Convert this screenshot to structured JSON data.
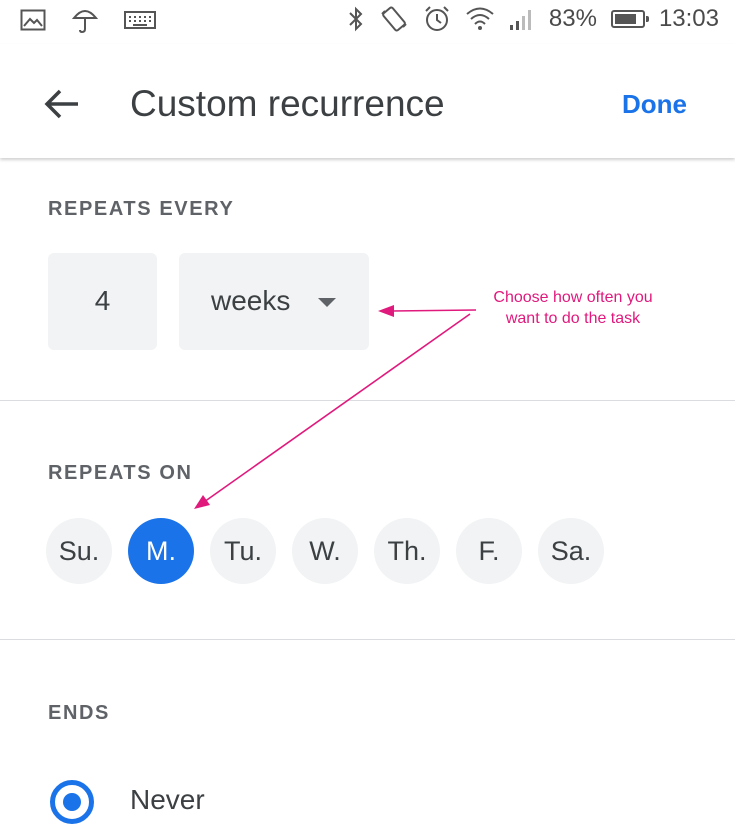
{
  "status_bar": {
    "battery_percent": "83%",
    "battery_level": 0.83,
    "time": "13:03",
    "icons": [
      "image-icon",
      "umbrella-icon",
      "keyboard-icon",
      "bluetooth-icon",
      "vibrate-icon",
      "alarm-icon",
      "wifi-icon",
      "signal-icon",
      "battery-icon"
    ]
  },
  "app_bar": {
    "title": "Custom recurrence",
    "done_label": "Done",
    "back_icon": "arrow-back-icon"
  },
  "repeats_every": {
    "label": "REPEATS EVERY",
    "count": "4",
    "unit": "weeks"
  },
  "repeats_on": {
    "label": "REPEATS ON",
    "days": [
      {
        "label": "Su.",
        "selected": false
      },
      {
        "label": "M.",
        "selected": true
      },
      {
        "label": "Tu.",
        "selected": false
      },
      {
        "label": "W.",
        "selected": false
      },
      {
        "label": "Th.",
        "selected": false
      },
      {
        "label": "F.",
        "selected": false
      },
      {
        "label": "Sa.",
        "selected": false
      }
    ]
  },
  "ends": {
    "label": "ENDS",
    "options": [
      {
        "label": "Never",
        "selected": true
      }
    ]
  },
  "annotation": {
    "line1": "Choose how often you",
    "line2": "want to do the task",
    "color": "#e0197d"
  },
  "colors": {
    "accent": "#1a73e8",
    "chip_bg": "#f1f3f4"
  }
}
